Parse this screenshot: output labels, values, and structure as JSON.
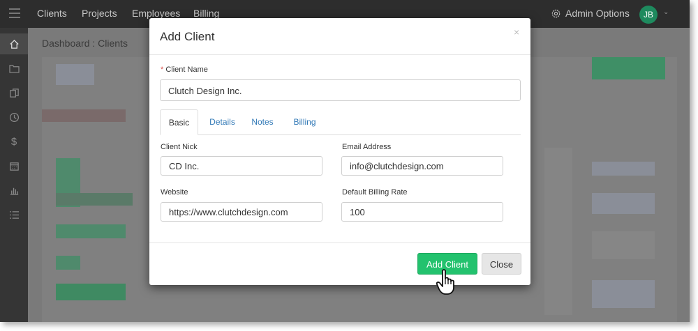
{
  "topnav": {
    "links": [
      "Clients",
      "Projects",
      "Employees",
      "Billing"
    ],
    "admin_label": "Admin Options",
    "avatar_initials": "JB"
  },
  "sidenav": {
    "icons": [
      "home-icon",
      "folder-icon",
      "documents-icon",
      "clock-icon",
      "dollar-icon",
      "calendar-icon",
      "chart-icon",
      "list-icon"
    ]
  },
  "page": {
    "breadcrumb": "Dashboard : Clients"
  },
  "modal": {
    "title": "Add Client",
    "close_symbol": "×",
    "client_name": {
      "label": "Client Name",
      "required_marker": "*",
      "value": "Clutch Design Inc."
    },
    "tabs": [
      {
        "label": "Basic",
        "active": true
      },
      {
        "label": "Details",
        "active": false
      },
      {
        "label": "Notes",
        "active": false
      },
      {
        "label": "Billing",
        "active": false
      }
    ],
    "fields": {
      "client_nick": {
        "label": "Client Nick",
        "value": "CD Inc."
      },
      "email": {
        "label": "Email Address",
        "value": "info@clutchdesign.com"
      },
      "website": {
        "label": "Website",
        "value": "https://www.clutchdesign.com"
      },
      "billing_rate": {
        "label": "Default Billing Rate",
        "value": "100"
      }
    },
    "buttons": {
      "primary": "Add Client",
      "secondary": "Close"
    }
  },
  "colors": {
    "primary_button": "#23c26e",
    "avatar": "#1e8a5e",
    "topnav": "#2d2d2d",
    "sidenav": "#353535",
    "link": "#337ab7"
  }
}
